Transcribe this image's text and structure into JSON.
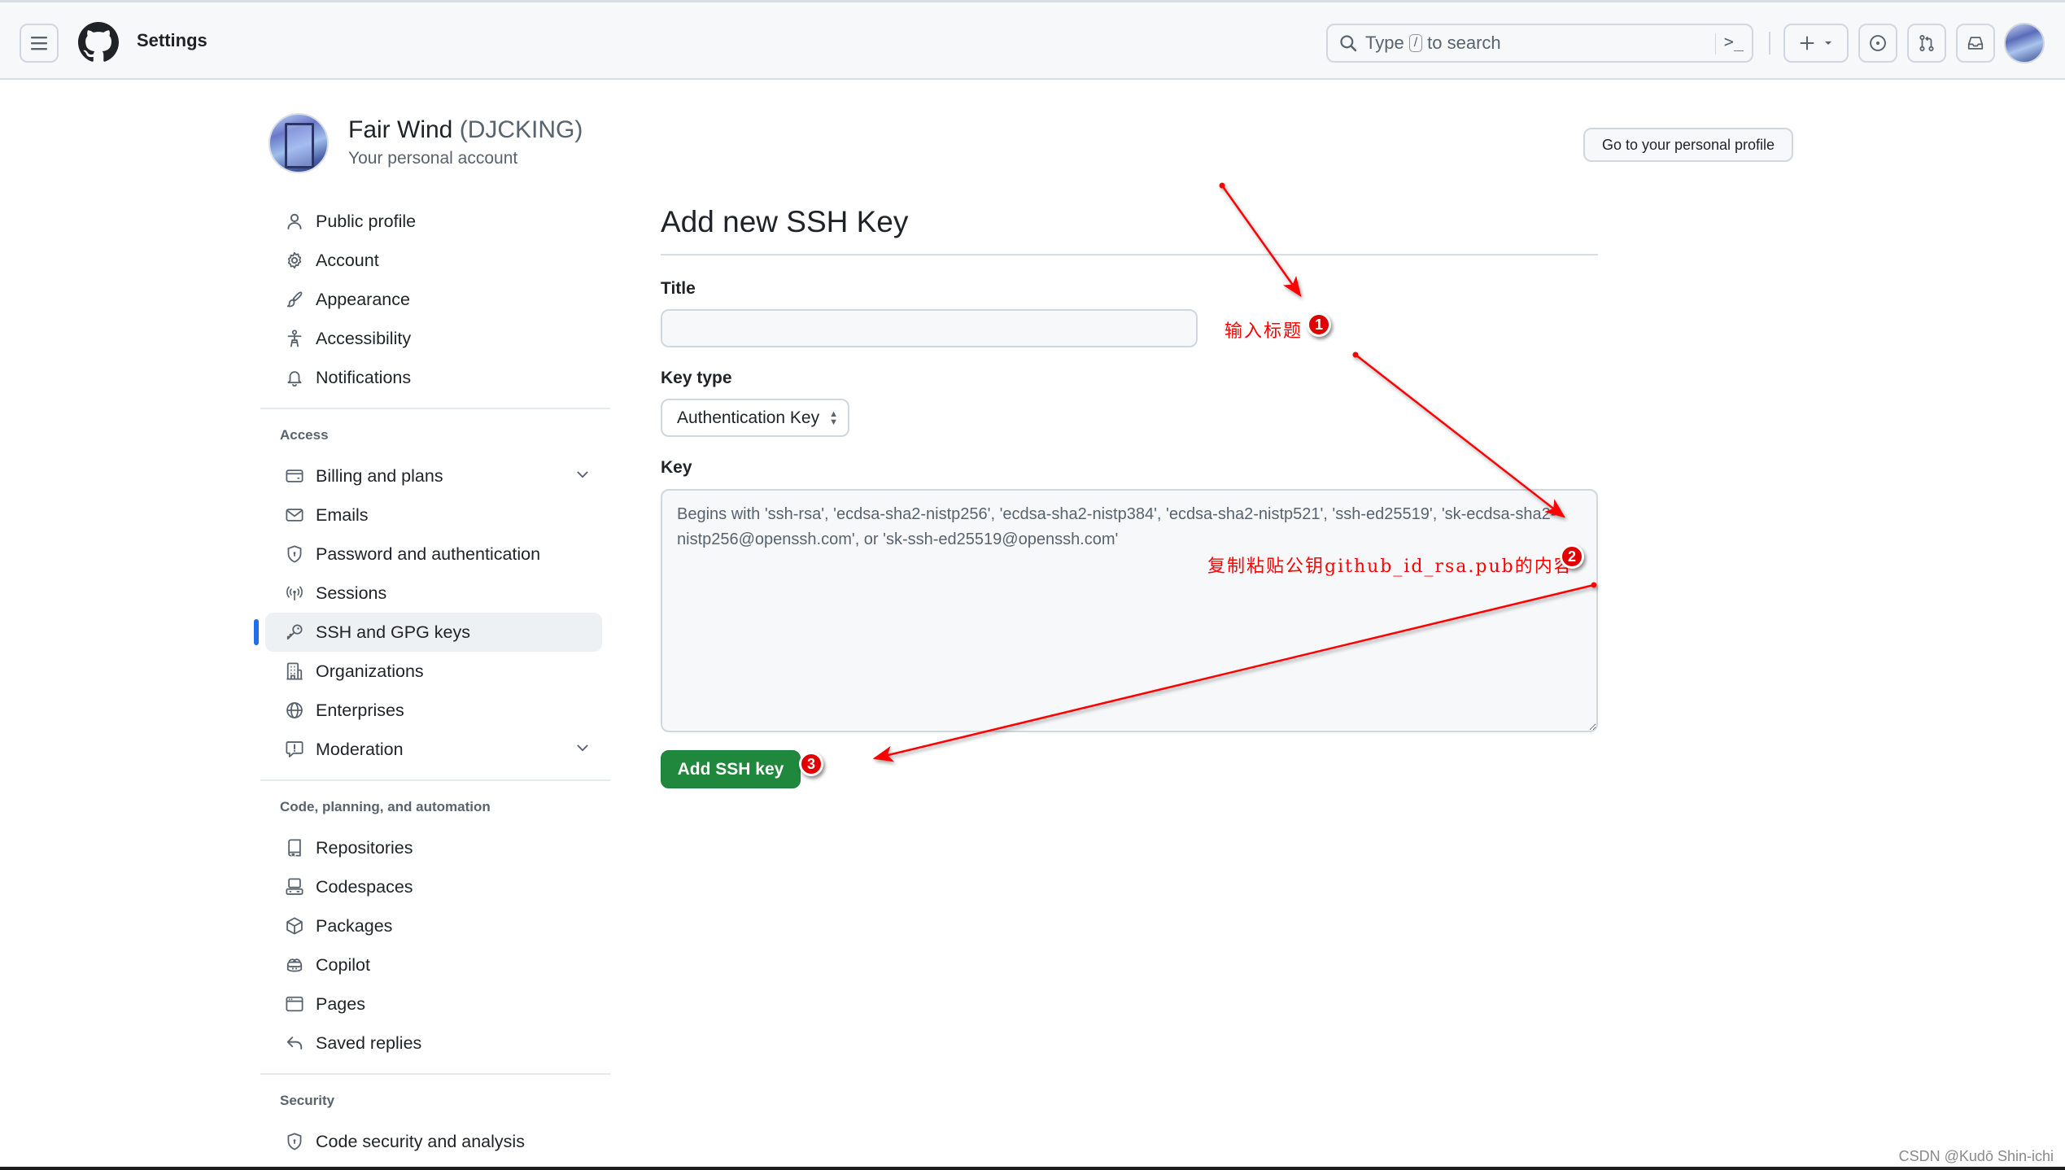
{
  "header": {
    "title": "Settings",
    "search": {
      "prefix": "Type",
      "key": "/",
      "suffix": "to search"
    },
    "buttons": [
      "create-new",
      "issues",
      "pull-requests",
      "inbox"
    ]
  },
  "profile": {
    "name": "Fair Wind",
    "login": "(DJCKING)",
    "subtitle": "Your personal account",
    "go_profile_label": "Go to your personal profile"
  },
  "sidebar": {
    "groups": [
      {
        "heading": null,
        "items": [
          {
            "label": "Public profile",
            "icon": "person-icon"
          },
          {
            "label": "Account",
            "icon": "gear-icon"
          },
          {
            "label": "Appearance",
            "icon": "paintbrush-icon"
          },
          {
            "label": "Accessibility",
            "icon": "accessibility-icon"
          },
          {
            "label": "Notifications",
            "icon": "bell-icon"
          }
        ]
      },
      {
        "heading": "Access",
        "items": [
          {
            "label": "Billing and plans",
            "icon": "credit-card-icon",
            "expandable": true
          },
          {
            "label": "Emails",
            "icon": "mail-icon"
          },
          {
            "label": "Password and authentication",
            "icon": "shield-lock-icon"
          },
          {
            "label": "Sessions",
            "icon": "broadcast-icon"
          },
          {
            "label": "SSH and GPG keys",
            "icon": "key-icon",
            "active": true
          },
          {
            "label": "Organizations",
            "icon": "organization-icon"
          },
          {
            "label": "Enterprises",
            "icon": "globe-icon"
          },
          {
            "label": "Moderation",
            "icon": "report-icon",
            "expandable": true
          }
        ]
      },
      {
        "heading": "Code, planning, and automation",
        "items": [
          {
            "label": "Repositories",
            "icon": "repo-icon"
          },
          {
            "label": "Codespaces",
            "icon": "codespaces-icon"
          },
          {
            "label": "Packages",
            "icon": "package-icon"
          },
          {
            "label": "Copilot",
            "icon": "copilot-icon"
          },
          {
            "label": "Pages",
            "icon": "browser-icon"
          },
          {
            "label": "Saved replies",
            "icon": "reply-icon"
          }
        ]
      },
      {
        "heading": "Security",
        "items": [
          {
            "label": "Code security and analysis",
            "icon": "shield-lock-icon"
          }
        ]
      }
    ]
  },
  "main": {
    "title": "Add new SSH Key",
    "title_field": {
      "label": "Title",
      "value": "",
      "placeholder": ""
    },
    "key_type": {
      "label": "Key type",
      "selected": "Authentication Key"
    },
    "key_field": {
      "label": "Key",
      "value": "",
      "placeholder": "Begins with 'ssh-rsa', 'ecdsa-sha2-nistp256', 'ecdsa-sha2-nistp384', 'ecdsa-sha2-nistp521', 'ssh-ed25519', 'sk-ecdsa-sha2-nistp256@openssh.com', or 'sk-ssh-ed25519@openssh.com'"
    },
    "submit_label": "Add SSH key"
  },
  "annotations": [
    {
      "number": "1",
      "text": "输入标题"
    },
    {
      "number": "2",
      "text": "复制粘贴公钥github_id_rsa.pub的内容"
    },
    {
      "number": "3",
      "text": ""
    }
  ],
  "colors": {
    "accent": "#1f6feb",
    "primary_button": "#1f883d",
    "annotation": "#ff0000"
  },
  "watermark": "CSDN @Kudō Shin-ichi"
}
